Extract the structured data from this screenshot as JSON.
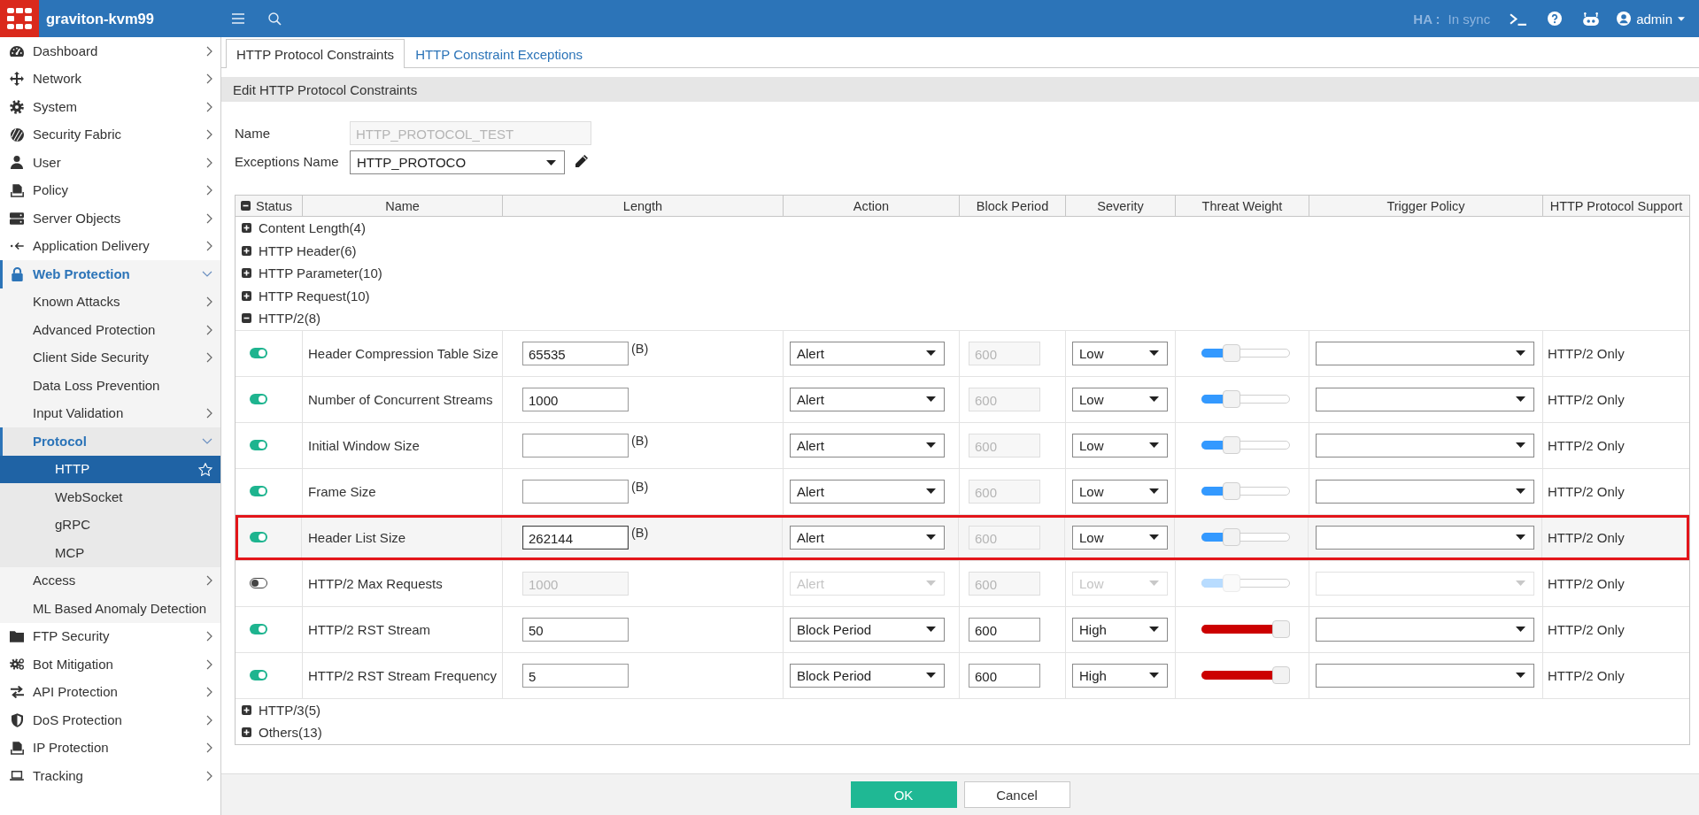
{
  "top_bar": {
    "hostname": "graviton-kvm99",
    "ha_label": "HA :",
    "ha_status": "In sync",
    "user": "admin"
  },
  "sidebar": {
    "items": [
      {
        "label": "Dashboard",
        "kind": "group",
        "expanded": false,
        "selected": false
      },
      {
        "label": "Network",
        "kind": "group",
        "expanded": false,
        "selected": false
      },
      {
        "label": "System",
        "kind": "group",
        "expanded": false,
        "selected": false
      },
      {
        "label": "Security Fabric",
        "kind": "group",
        "expanded": false,
        "selected": false
      },
      {
        "label": "User",
        "kind": "group",
        "expanded": false,
        "selected": false
      },
      {
        "label": "Policy",
        "kind": "group",
        "expanded": false,
        "selected": false
      },
      {
        "label": "Server Objects",
        "kind": "group",
        "expanded": false,
        "selected": false
      },
      {
        "label": "Application Delivery",
        "kind": "group",
        "expanded": false,
        "selected": false
      },
      {
        "label": "Web Protection",
        "kind": "group",
        "expanded": true,
        "selected": false,
        "children": [
          {
            "label": "Known Attacks",
            "kind": "group",
            "expanded": false,
            "selected": false
          },
          {
            "label": "Advanced Protection",
            "kind": "group",
            "expanded": false,
            "selected": false
          },
          {
            "label": "Client Side Security",
            "kind": "group",
            "expanded": false,
            "selected": false
          },
          {
            "label": "Data Loss Prevention",
            "kind": "page",
            "selected": false
          },
          {
            "label": "Input Validation",
            "kind": "group",
            "expanded": false,
            "selected": false
          },
          {
            "label": "Protocol",
            "kind": "group",
            "expanded": true,
            "selected": false,
            "children": [
              {
                "label": "HTTP",
                "kind": "page",
                "selected": true
              },
              {
                "label": "WebSocket",
                "kind": "page",
                "selected": false
              },
              {
                "label": "gRPC",
                "kind": "page",
                "selected": false
              },
              {
                "label": "MCP",
                "kind": "page",
                "selected": false
              }
            ]
          },
          {
            "label": "Access",
            "kind": "group",
            "expanded": false,
            "selected": false
          },
          {
            "label": "ML Based Anomaly Detection",
            "kind": "page",
            "selected": false
          }
        ]
      },
      {
        "label": "FTP Security",
        "kind": "group",
        "expanded": false,
        "selected": false
      },
      {
        "label": "Bot Mitigation",
        "kind": "group",
        "expanded": false,
        "selected": false
      },
      {
        "label": "API Protection",
        "kind": "group",
        "expanded": false,
        "selected": false
      },
      {
        "label": "DoS Protection",
        "kind": "group",
        "expanded": false,
        "selected": false
      },
      {
        "label": "IP Protection",
        "kind": "group",
        "expanded": false,
        "selected": false
      },
      {
        "label": "Tracking",
        "kind": "group",
        "expanded": false,
        "selected": false
      }
    ]
  },
  "tabs": [
    {
      "label": "HTTP Protocol Constraints",
      "selected": true
    },
    {
      "label": "HTTP Constraint Exceptions",
      "selected": false
    }
  ],
  "form": {
    "title": "Edit HTTP Protocol Constraints",
    "name": {
      "label": "Name",
      "value": "HTTP_PROTOCOL_TEST",
      "disabled": true
    },
    "exceptions_name": {
      "label": "Exceptions Name",
      "value": "HTTP_PROTOCO"
    }
  },
  "table": {
    "columns": [
      "Status",
      "Name",
      "Length",
      "Action",
      "Block Period",
      "Severity",
      "Threat Weight",
      "Trigger Policy",
      "HTTP Protocol Support"
    ],
    "groups": [
      {
        "label": "Content Length(4)",
        "expanded": false
      },
      {
        "label": "HTTP Header(6)",
        "expanded": false
      },
      {
        "label": "HTTP Parameter(10)",
        "expanded": false
      },
      {
        "label": "HTTP Request(10)",
        "expanded": false
      },
      {
        "label": "HTTP/2(8)",
        "expanded": true,
        "rows": [
          {
            "enabled": true,
            "name": "Header Compression Table Size",
            "length": {
              "value": "65535",
              "unit": "(B)",
              "focused": false
            },
            "action": "Alert",
            "block_period": {
              "value": "600",
              "disabled": true
            },
            "severity": "Low",
            "threat_weight": {
              "level": 0.3,
              "color": "#3399ff"
            },
            "support": "HTTP/2 Only",
            "highlighted": false
          },
          {
            "enabled": true,
            "name": "Number of Concurrent Streams",
            "length": {
              "value": "1000",
              "focused": false
            },
            "action": "Alert",
            "block_period": {
              "value": "600",
              "disabled": true
            },
            "severity": "Low",
            "threat_weight": {
              "level": 0.3,
              "color": "#3399ff"
            },
            "support": "HTTP/2 Only",
            "highlighted": false
          },
          {
            "enabled": true,
            "name": "Initial Window Size",
            "length": {
              "unit": "(B)",
              "focused": false
            },
            "action": "Alert",
            "block_period": {
              "value": "600",
              "disabled": true
            },
            "severity": "Low",
            "threat_weight": {
              "level": 0.3,
              "color": "#3399ff"
            },
            "support": "HTTP/2 Only",
            "highlighted": false
          },
          {
            "enabled": true,
            "name": "Frame Size",
            "length": {
              "unit": "(B)",
              "focused": false
            },
            "action": "Alert",
            "block_period": {
              "value": "600",
              "disabled": true
            },
            "severity": "Low",
            "threat_weight": {
              "level": 0.3,
              "color": "#3399ff"
            },
            "support": "HTTP/2 Only",
            "highlighted": false
          },
          {
            "enabled": true,
            "name": "Header List Size",
            "length": {
              "value": "262144",
              "unit": "(B)",
              "focused": true
            },
            "action": "Alert",
            "block_period": {
              "value": "600",
              "disabled": true
            },
            "severity": "Low",
            "threat_weight": {
              "level": 0.3,
              "color": "#3399ff"
            },
            "support": "HTTP/2 Only",
            "highlighted": true
          },
          {
            "enabled": false,
            "name": "HTTP/2 Max Requests",
            "length": {
              "value": "1000",
              "focused": false
            },
            "action": "Alert",
            "block_period": {
              "value": "600",
              "disabled": true
            },
            "severity": "Low",
            "threat_weight": {
              "level": 0.3,
              "color": "#b8dcff"
            },
            "support": "HTTP/2 Only",
            "highlighted": false
          },
          {
            "enabled": true,
            "name": "HTTP/2 RST Stream",
            "length": {
              "value": "50",
              "focused": false
            },
            "action": "Block Period",
            "block_period": {
              "value": "600",
              "disabled": false
            },
            "severity": "High",
            "threat_weight": {
              "level": 1,
              "color": "#cc0000"
            },
            "support": "HTTP/2 Only",
            "highlighted": false
          },
          {
            "enabled": true,
            "name": "HTTP/2 RST Stream Frequency",
            "length": {
              "value": "5",
              "focused": false
            },
            "action": "Block Period",
            "block_period": {
              "value": "600",
              "disabled": false
            },
            "severity": "High",
            "threat_weight": {
              "level": 1,
              "color": "#cc0000"
            },
            "support": "HTTP/2 Only",
            "highlighted": false
          }
        ]
      },
      {
        "label": "HTTP/3(5)",
        "expanded": false
      },
      {
        "label": "Others(13)",
        "expanded": false
      }
    ]
  },
  "buttons": [
    {
      "label": "OK",
      "kind": "primary"
    },
    {
      "label": "Cancel",
      "kind": "secondary"
    }
  ]
}
